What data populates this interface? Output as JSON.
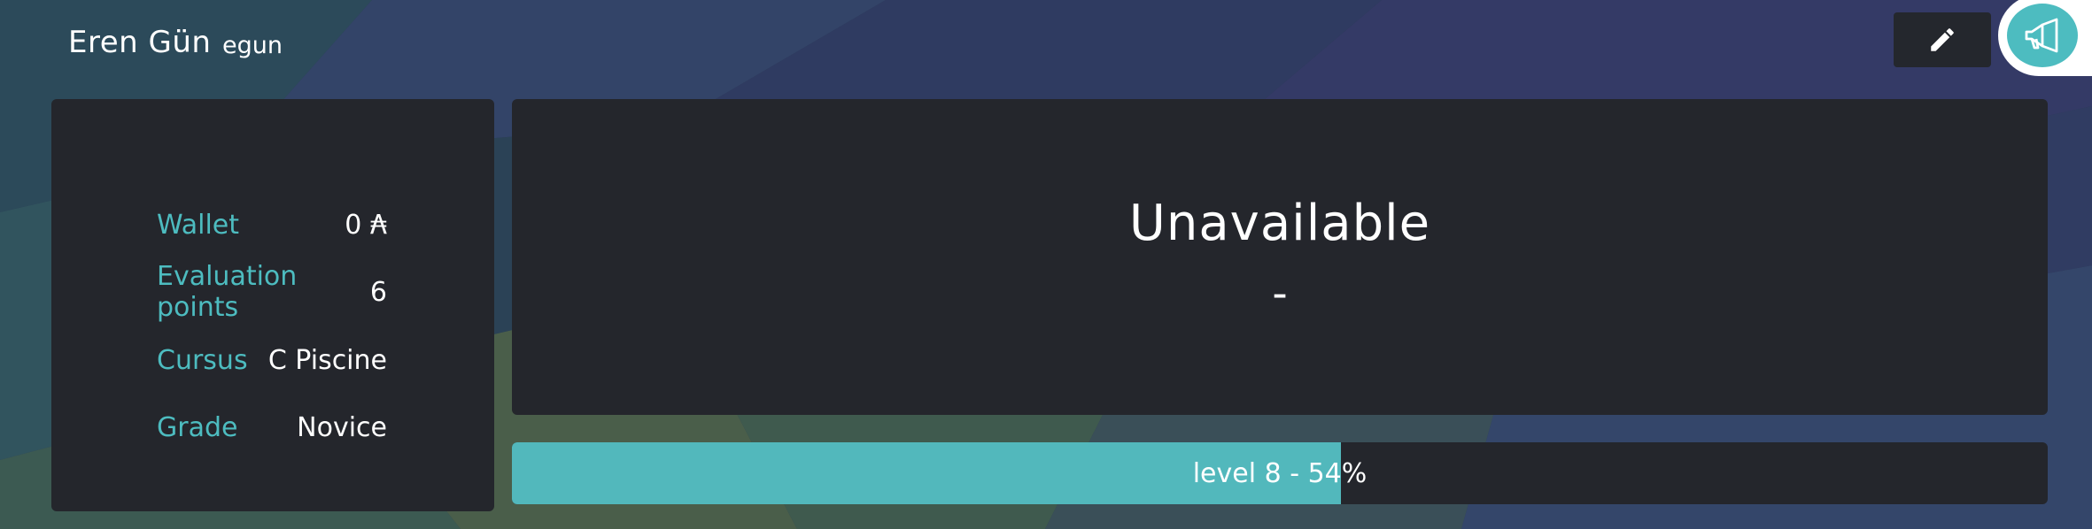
{
  "user": {
    "display_name": "Eren Gün",
    "login": "egun"
  },
  "icons": {
    "edit": "pencil-icon",
    "announce": "megaphone-icon"
  },
  "colors": {
    "accent": "#4dbcc0",
    "panel": "#24262c",
    "text": "#ffffff"
  },
  "info": {
    "wallet_label": "Wallet",
    "wallet_value": "0 ₳",
    "evaluation_points_label": "Evaluation points",
    "evaluation_points_value": "6",
    "cursus_label": "Cursus",
    "cursus_value": "C Piscine",
    "grade_label": "Grade",
    "grade_value": "Novice"
  },
  "status": {
    "title": "Unavailable",
    "subtitle": "-"
  },
  "level": {
    "text": "level 8 - 54%",
    "progress_percent": 54
  }
}
